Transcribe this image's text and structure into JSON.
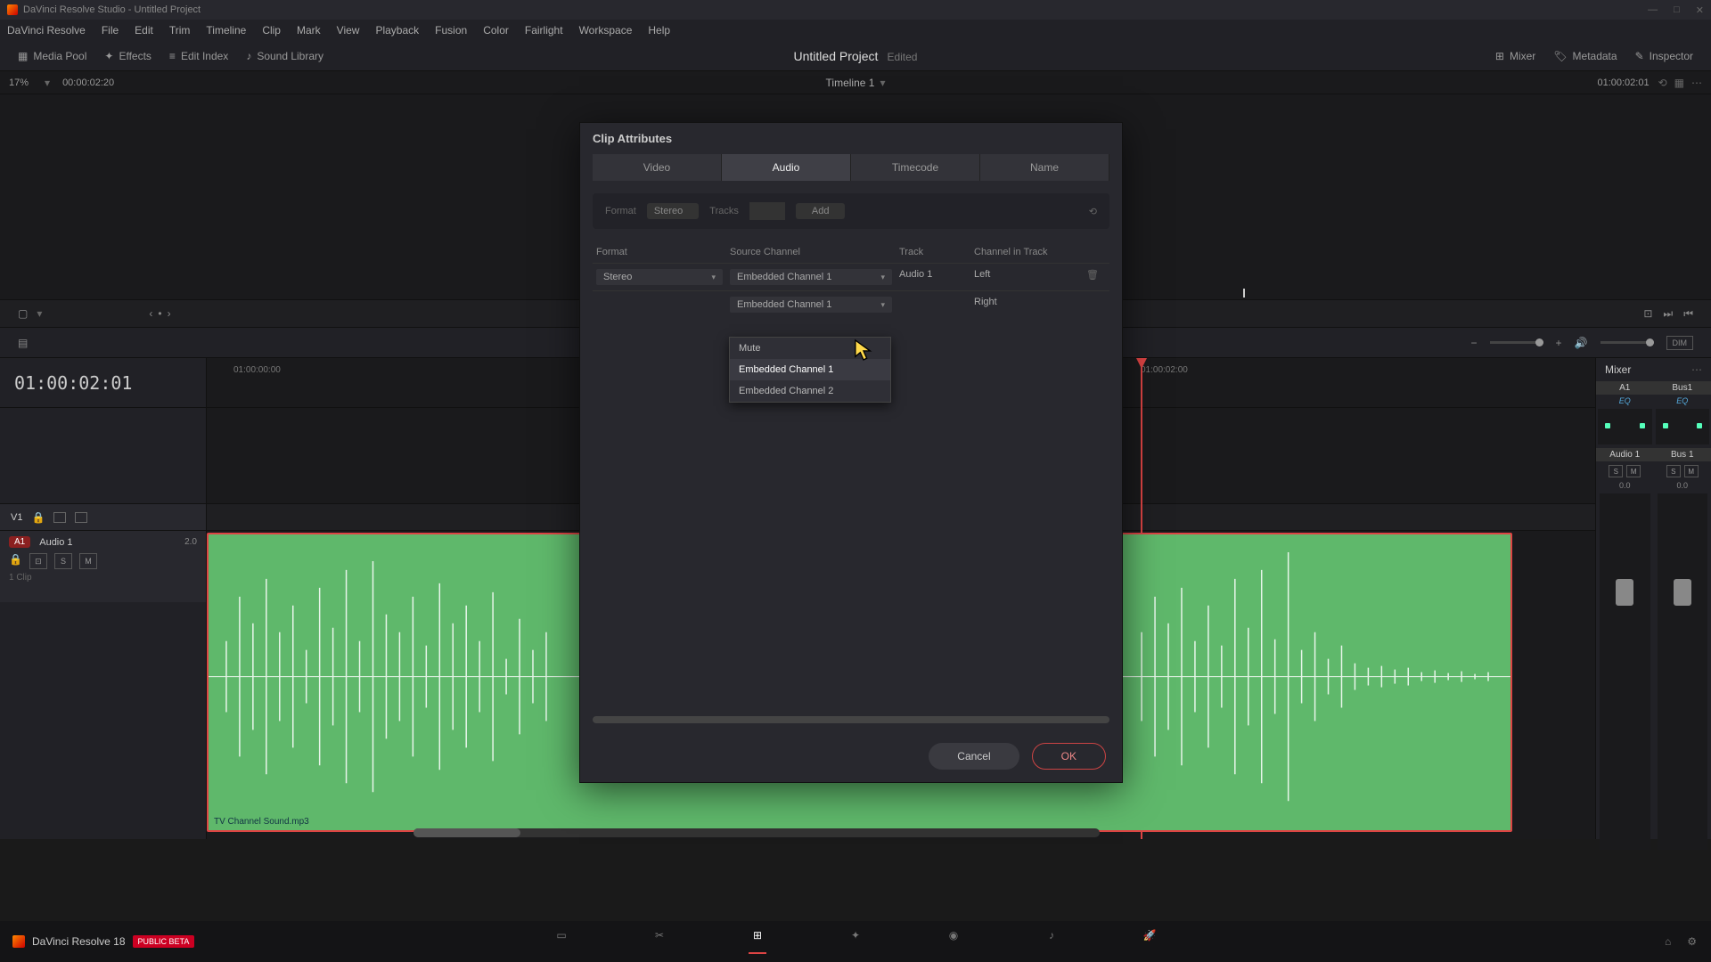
{
  "titlebar": {
    "text": "DaVinci Resolve Studio - Untitled Project"
  },
  "menus": [
    "DaVinci Resolve",
    "File",
    "Edit",
    "Trim",
    "Timeline",
    "Clip",
    "Mark",
    "View",
    "Playback",
    "Fusion",
    "Color",
    "Fairlight",
    "Workspace",
    "Help"
  ],
  "toolbar": {
    "media_pool": "Media Pool",
    "effects": "Effects",
    "edit_index": "Edit Index",
    "sound_library": "Sound Library",
    "mixer": "Mixer",
    "metadata": "Metadata",
    "inspector": "Inspector"
  },
  "project": {
    "title": "Untitled Project",
    "status": "Edited"
  },
  "timeline_header": {
    "zoom": "17%",
    "tc_left": "00:00:02:20",
    "name": "Timeline 1",
    "tc_right": "01:00:02:01"
  },
  "big_tc": "01:00:02:01",
  "ruler": {
    "t0": "01:00:00:00",
    "t1": "01:00:02:00"
  },
  "tracks": {
    "v1": "V1",
    "a1": {
      "tag": "A1",
      "name": "Audio 1",
      "ch": "2.0",
      "s": "S",
      "m": "M",
      "clip_count": "1 Clip"
    }
  },
  "clip": {
    "name": "TV Channel Sound.mp3"
  },
  "mixer_panel": {
    "title": "Mixer",
    "ch1": {
      "name": "A1",
      "eq": "EQ",
      "db": "0.0",
      "s": "S",
      "m": "M",
      "bus": "Audio 1"
    },
    "ch2": {
      "name": "Bus1",
      "eq": "EQ",
      "db": "0.0",
      "s": "S",
      "m": "M",
      "bus": "Bus 1"
    },
    "dim": "DIM"
  },
  "dialog": {
    "title": "Clip Attributes",
    "tabs": {
      "video": "Video",
      "audio": "Audio",
      "timecode": "Timecode",
      "name": "Name"
    },
    "format_label": "Format",
    "format_value": "Stereo",
    "tracks_label": "Tracks",
    "add": "Add",
    "headers": {
      "format": "Format",
      "source": "Source Channel",
      "track": "Track",
      "ch_track": "Channel in Track"
    },
    "row": {
      "format": "Stereo",
      "src1": "Embedded Channel 1",
      "src2": "Embedded Channel 1",
      "track": "Audio 1",
      "ch1": "Left",
      "ch2": "Right"
    },
    "menu": {
      "mute": "Mute",
      "opt1": "Embedded Channel 1",
      "opt2": "Embedded Channel 2"
    },
    "cancel": "Cancel",
    "ok": "OK"
  },
  "footer": {
    "app": "DaVinci Resolve 18",
    "beta": "PUBLIC BETA"
  }
}
